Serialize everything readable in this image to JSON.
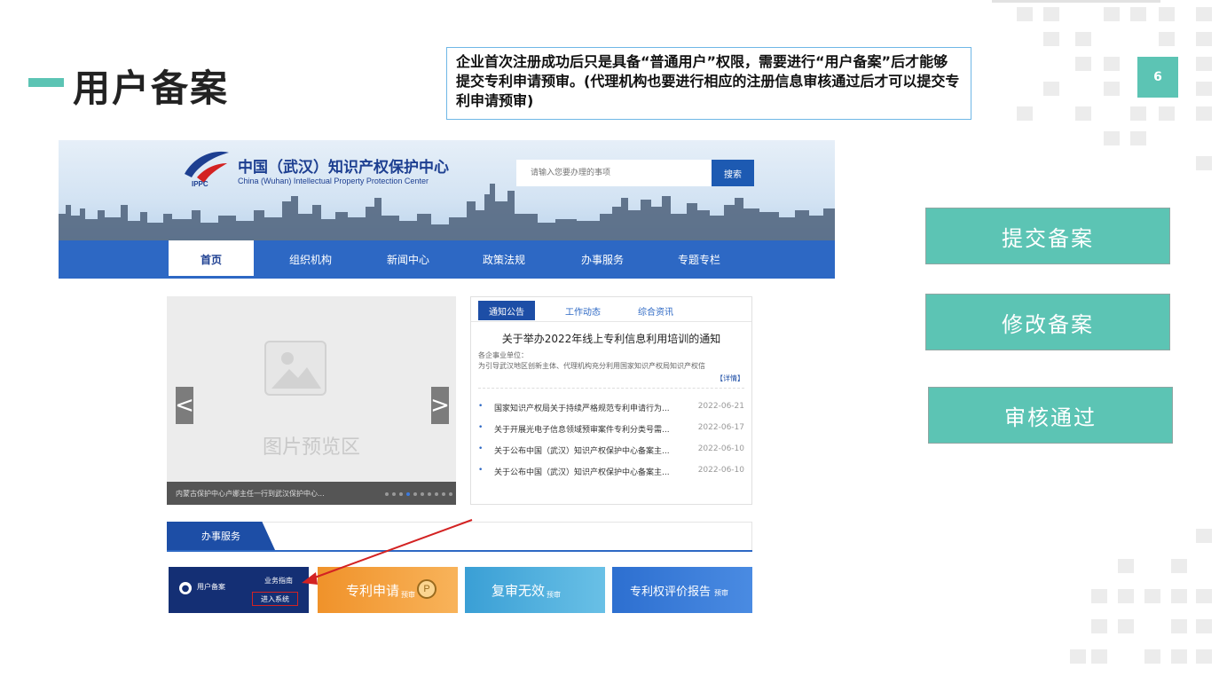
{
  "slide": {
    "title": "用户备案",
    "note": "企业首次注册成功后只是具备“普通用户”权限，需要进行“用户备案”后才能够提交专利申请预审。(代理机构也要进行相应的注册信息审核通过后才可以提交专利申请预审)",
    "page_number": "6",
    "accent_color": "#5cc4b4"
  },
  "site": {
    "logo_text": "中国（武汉）知识产权保护中心",
    "logo_en": "China (Wuhan) Intellectual Property Protection Center",
    "logo_abbr": "IPPC",
    "search_placeholder": "请输入您要办理的事项",
    "search_button": "搜索",
    "nav": [
      "首页",
      "组织机构",
      "新闻中心",
      "政策法规",
      "办事服务",
      "专题专栏"
    ],
    "carousel": {
      "placeholder": "图片预览区",
      "caption": "内蒙古保护中心卢娜主任一行到武汉保护中心...",
      "prev": "<",
      "next": ">"
    },
    "news": {
      "tabs": [
        "通知公告",
        "工作动态",
        "综合资讯"
      ],
      "headline": "关于举办2022年线上专利信息利用培训的通知",
      "sub_line1": "各企事业单位：",
      "sub_line2": "为引导武汉地区创新主体、代理机构充分利用国家知识产权局知识产权信",
      "more": "【详情】",
      "items": [
        {
          "title": "国家知识产权局关于持续严格规范专利申请行为...",
          "date": "2022-06-21"
        },
        {
          "title": "关于开展光电子信息领域预审案件专利分类号需...",
          "date": "2022-06-17"
        },
        {
          "title": "关于公布中国（武汉）知识产权保护中心备案主...",
          "date": "2022-06-10"
        },
        {
          "title": "关于公布中国（武汉）知识产权保护中心备案主...",
          "date": "2022-06-10"
        }
      ]
    },
    "service": {
      "tab": "办事服务",
      "user_tile": {
        "label": "用户备案",
        "guide": "业务指南",
        "enter": "进入系统"
      },
      "tiles": [
        "专利申请",
        "复审无效",
        "专利权评价报告"
      ],
      "tile_tags": [
        "预审",
        "预审",
        "预审"
      ],
      "badge": "P"
    }
  },
  "actions": [
    "提交备案",
    "修改备案",
    "审核通过"
  ]
}
